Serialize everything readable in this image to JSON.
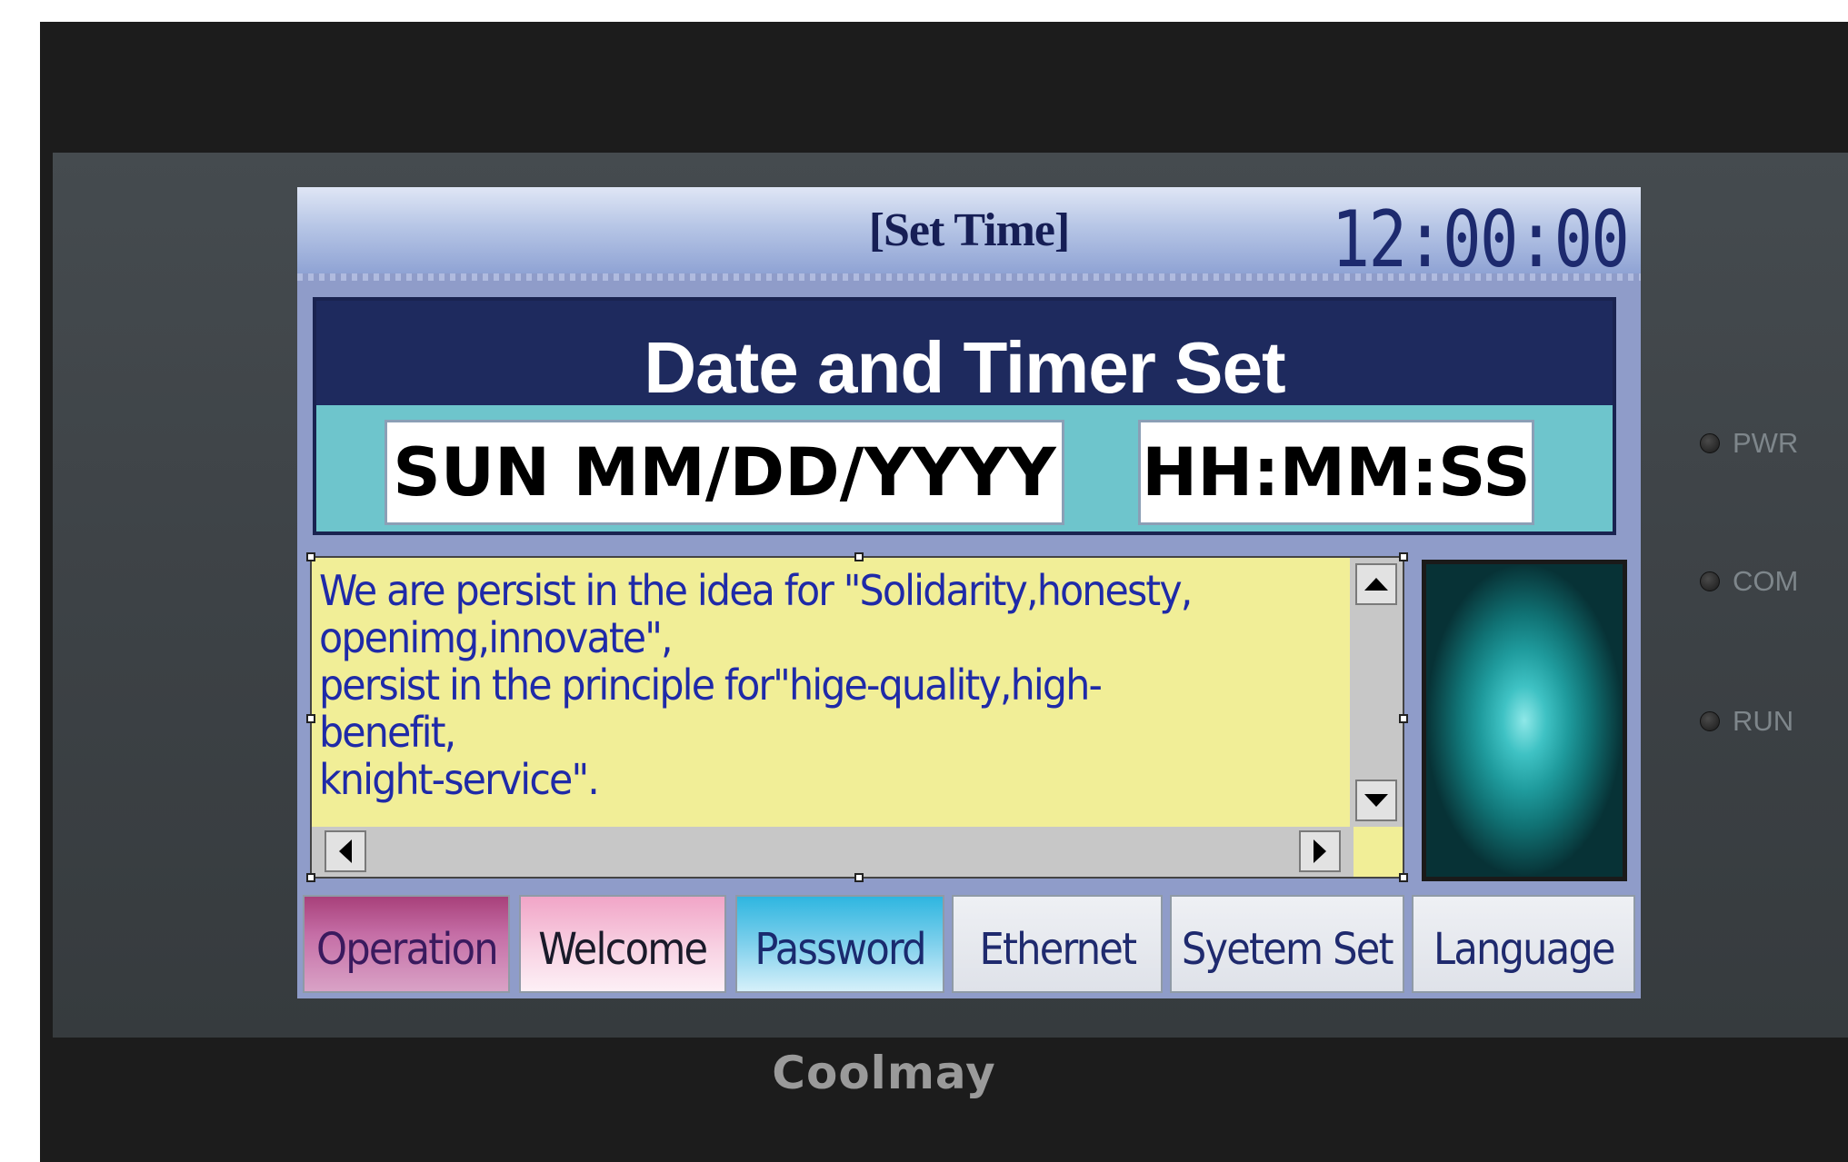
{
  "device": {
    "brand": "Coolmay",
    "indicators": [
      {
        "label": "PWR"
      },
      {
        "label": "COM"
      },
      {
        "label": "RUN"
      }
    ]
  },
  "screen": {
    "title": "[Set Time]",
    "clock": "12:00:00",
    "date_panel": {
      "heading": "Date and Timer Set",
      "date_value": "SUN MM/DD/YYYY",
      "time_value": "HH:MM:SS"
    },
    "message": {
      "text": "We are persist in the idea for \"Solidarity,honesty,\nopenimg,innovate\",\npersist in the principle for\"hige-quality,high-benefit,\nknight-service\"."
    },
    "tabs": [
      {
        "label": "Operation"
      },
      {
        "label": "Welcome"
      },
      {
        "label": "Password"
      },
      {
        "label": "Ethernet"
      },
      {
        "label": "Syetem Set"
      },
      {
        "label": "Language"
      }
    ]
  },
  "colors": {
    "bezel": "#1c1c1c",
    "screen_bg": "#8f9cc9",
    "header_navy": "#1e2a5e",
    "date_panel_bg": "#6ec5cc",
    "message_bg": "#f1ee97",
    "message_text": "#1f2aa8"
  }
}
